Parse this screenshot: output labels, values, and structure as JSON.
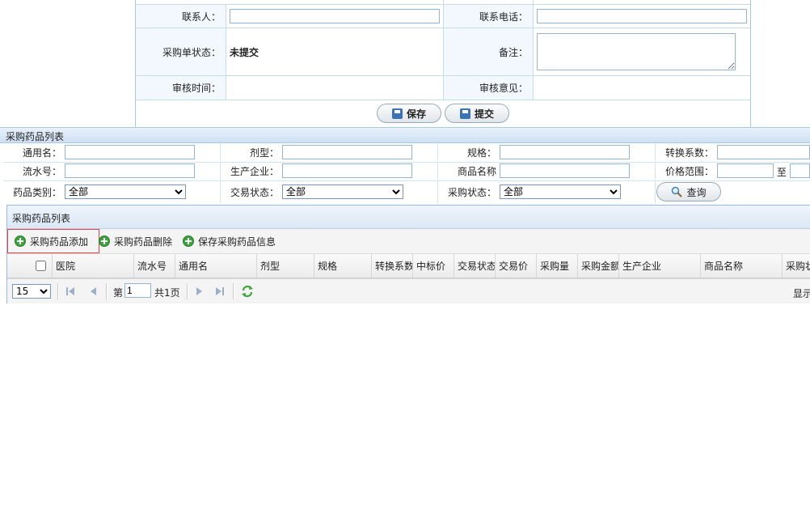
{
  "form": {
    "contact_label": "联系人：",
    "contact_value": "",
    "phone_label": "联系电话：",
    "phone_value": "",
    "status_label": "采购单状态：",
    "status_value": "未提交",
    "remark_label": "备注：",
    "audit_time_label": "审核时间：",
    "audit_opinion_label": "审核意见：",
    "save_label": "保存",
    "submit_label": "提交"
  },
  "query": {
    "title": "采购药品列表",
    "common_name_label": "通用名：",
    "dosage_label": "剂型：",
    "spec_label": "规格：",
    "ratio_label": "转换系数：",
    "serial_label": "流水号：",
    "manufacturer_label": "生产企业：",
    "product_name_label": "商品名称",
    "price_range_label": "价格范围：",
    "price_to": "至",
    "category_label": "药品类别：",
    "category_value": "全部",
    "trade_status_label": "交易状态：",
    "trade_status_value": "全部",
    "purchase_status_label": "采购状态：",
    "purchase_status_value": "全部",
    "search_label": "查询"
  },
  "grid": {
    "title": "采购药品列表",
    "toolbar": {
      "add_label": "采购药品添加",
      "delete_label": "采购药品删除",
      "save_label": "保存采购药品信息"
    },
    "columns": [
      "医院",
      "流水号",
      "通用名",
      "剂型",
      "规格",
      "转换系数",
      "中标价",
      "交易状态",
      "交易价",
      "采购量",
      "采购金额",
      "生产企业",
      "商品名称",
      "采购状"
    ],
    "pager": {
      "page_size": "15",
      "page_prefix": "第",
      "page_value": "1",
      "page_total": "共1页",
      "display_text": "显示"
    }
  },
  "colors": {
    "header_bg": "#cfe0f2",
    "border": "#99bbe8",
    "add_icon": "#3da33d"
  }
}
